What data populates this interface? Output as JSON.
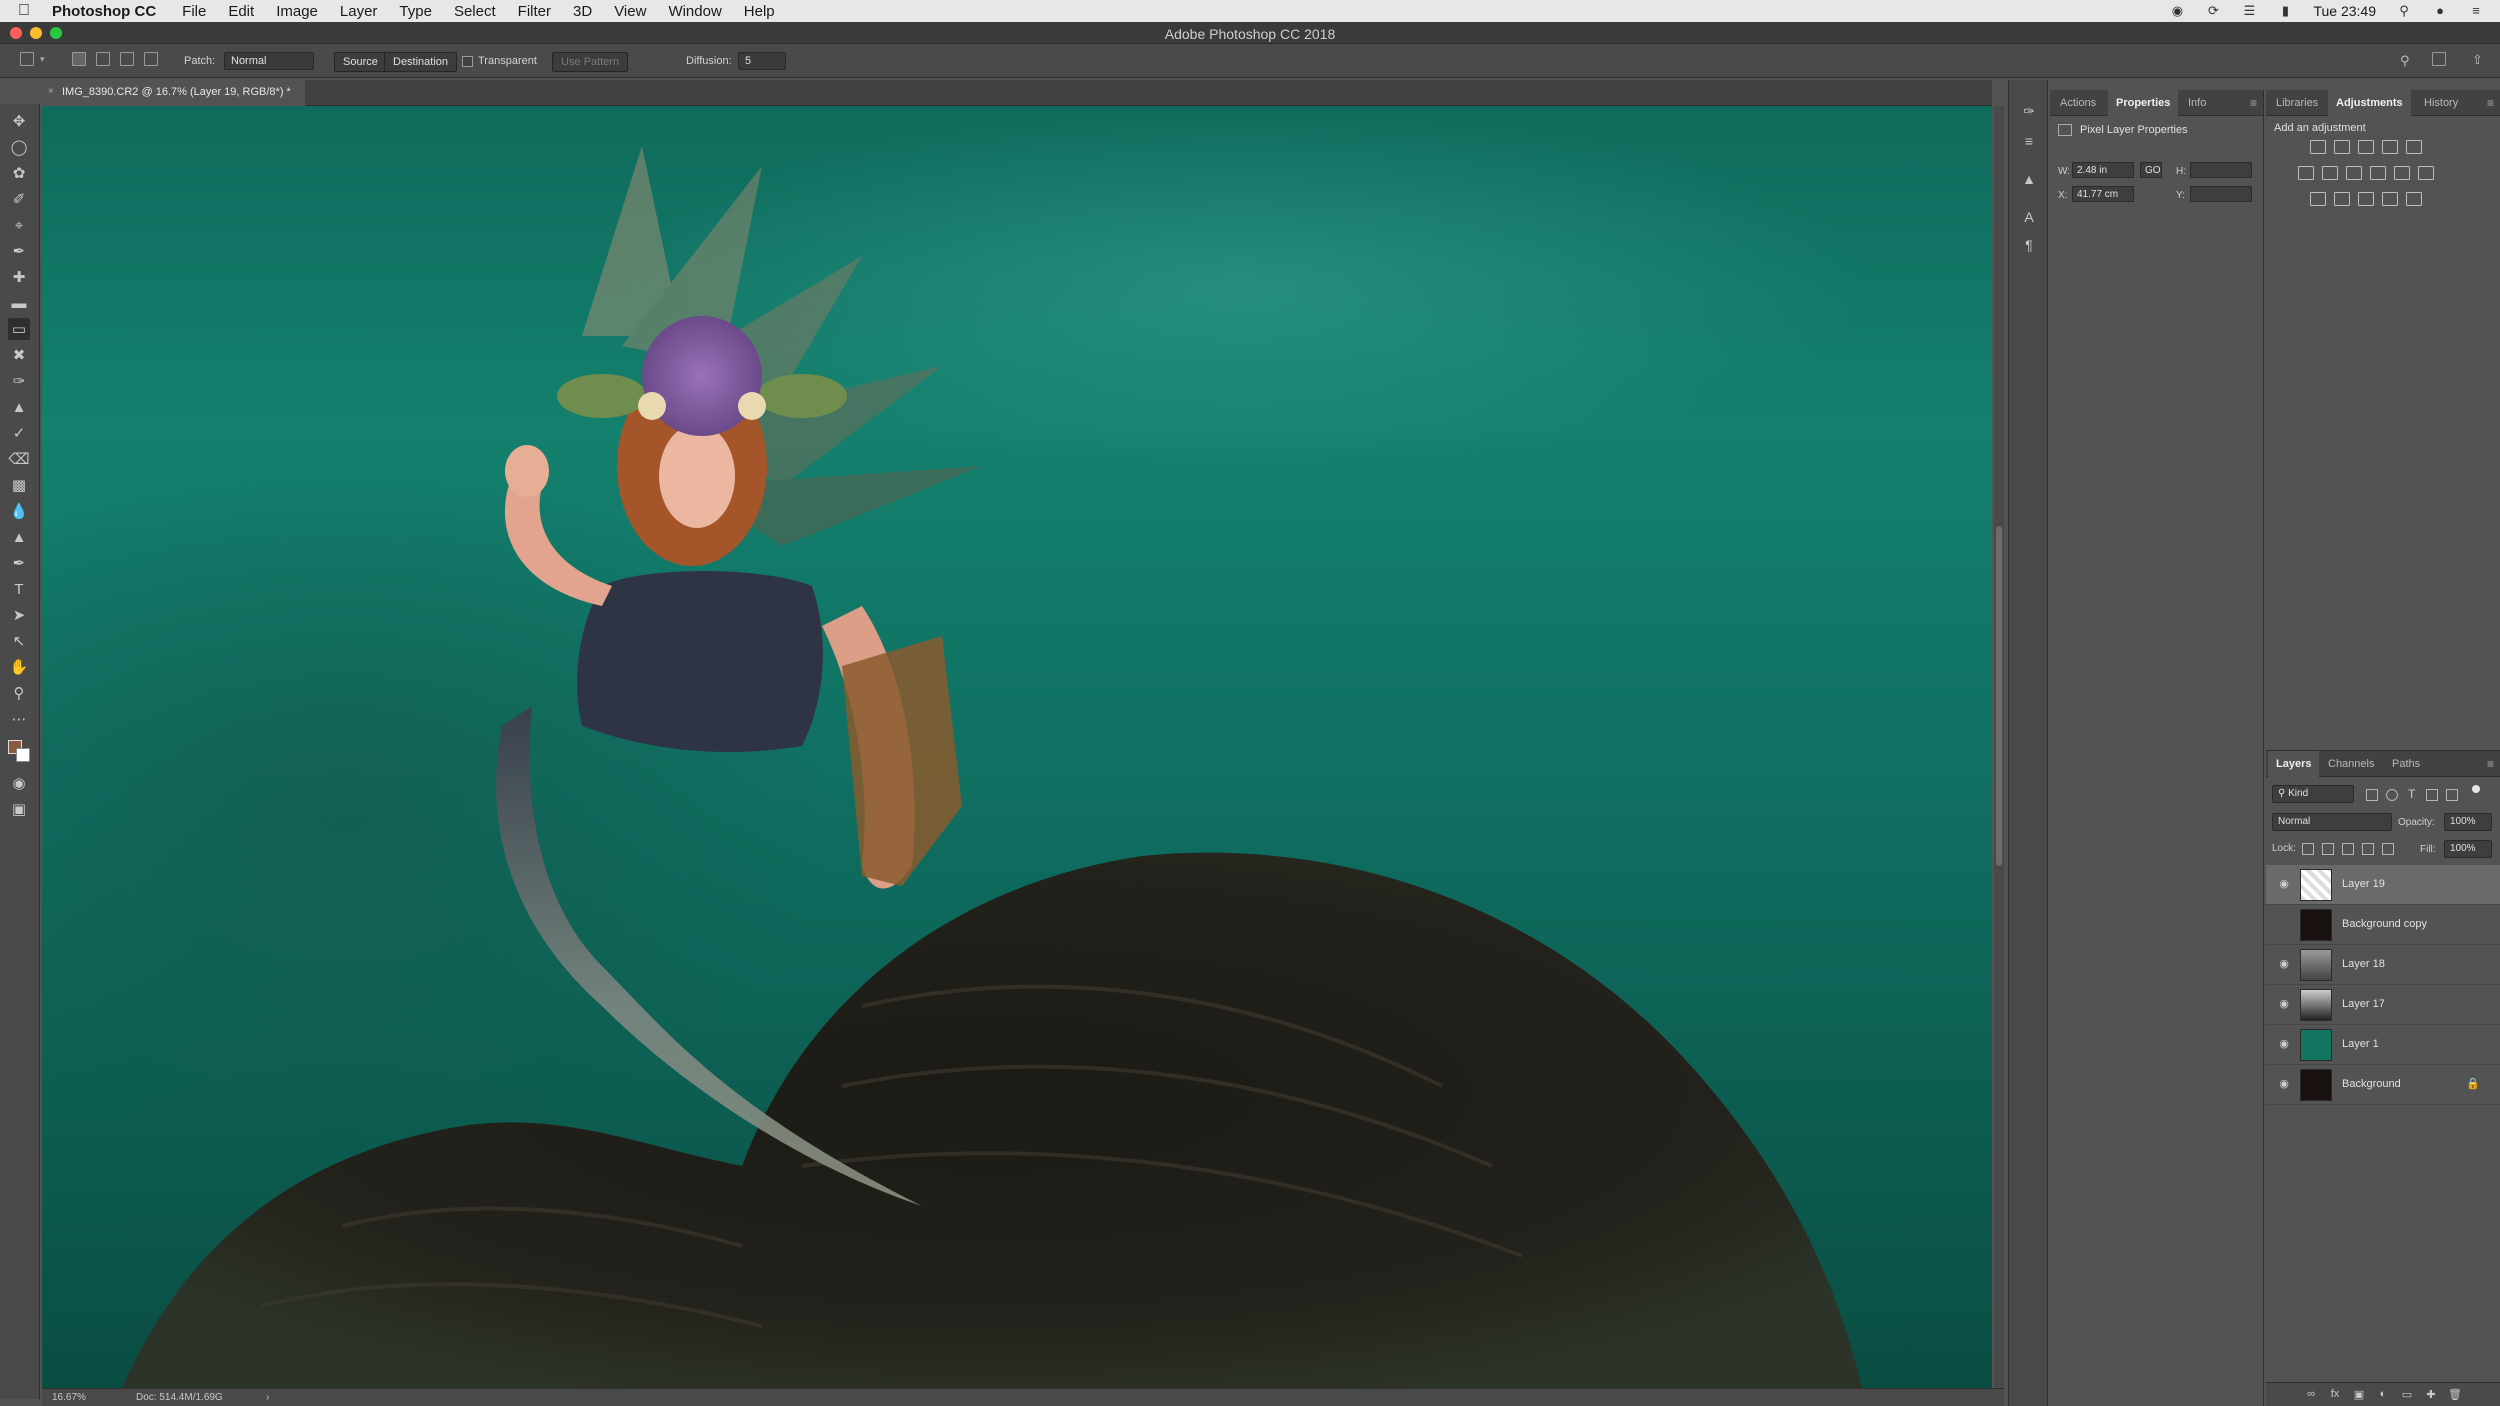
{
  "menubar": {
    "app_name": "Photoshop CC",
    "menus": [
      "File",
      "Edit",
      "Image",
      "Layer",
      "Type",
      "Select",
      "Filter",
      "3D",
      "View",
      "Window",
      "Help"
    ],
    "clock": "Tue 23:49"
  },
  "window": {
    "title": "Adobe Photoshop CC 2018"
  },
  "options": {
    "patch_label": "Patch:",
    "patch_value": "Normal",
    "source_label": "Source",
    "destination_label": "Destination",
    "transparent_label": "Transparent",
    "use_pattern_label": "Use Pattern",
    "diffusion_label": "Diffusion:",
    "diffusion_value": "5"
  },
  "document": {
    "tab_title": "IMG_8390.CR2 @ 16.7% (Layer 19, RGB/8*) *",
    "zoom": "16.67%",
    "doc_size": "Doc: 514.4M/1.69G"
  },
  "properties": {
    "tabs": [
      "Actions",
      "Properties",
      "Info"
    ],
    "active_tab": "Properties",
    "header": "Pixel Layer Properties",
    "w_label": "W:",
    "w_value": "2.48 in",
    "link_label": "GO",
    "h_label": "H:",
    "h_value": "",
    "x_label": "X:",
    "x_value": "41.77 cm",
    "y_label": "Y:",
    "y_value": ""
  },
  "adjustments": {
    "tabs": [
      "Libraries",
      "Adjustments",
      "History"
    ],
    "active_tab": "Adjustments",
    "label": "Add an adjustment"
  },
  "layers": {
    "tabs": [
      "Layers",
      "Channels",
      "Paths"
    ],
    "active_tab": "Layers",
    "filter_kind": "Kind",
    "blend_mode": "Normal",
    "opacity_label": "Opacity:",
    "opacity_value": "100%",
    "lock_label": "Lock:",
    "fill_label": "Fill:",
    "fill_value": "100%",
    "items": [
      {
        "name": "Layer 19",
        "visible": true,
        "selected": true,
        "locked": false
      },
      {
        "name": "Background copy",
        "visible": false,
        "selected": false,
        "locked": false
      },
      {
        "name": "Layer 18",
        "visible": true,
        "selected": false,
        "locked": false
      },
      {
        "name": "Layer 17",
        "visible": true,
        "selected": false,
        "locked": false
      },
      {
        "name": "Layer 1",
        "visible": true,
        "selected": false,
        "locked": false
      },
      {
        "name": "Background",
        "visible": true,
        "selected": false,
        "locked": true
      }
    ]
  },
  "colors": {
    "foreground": "#8a5a3c",
    "background": "#ffffff",
    "accent_water": "#0f6b5c"
  }
}
